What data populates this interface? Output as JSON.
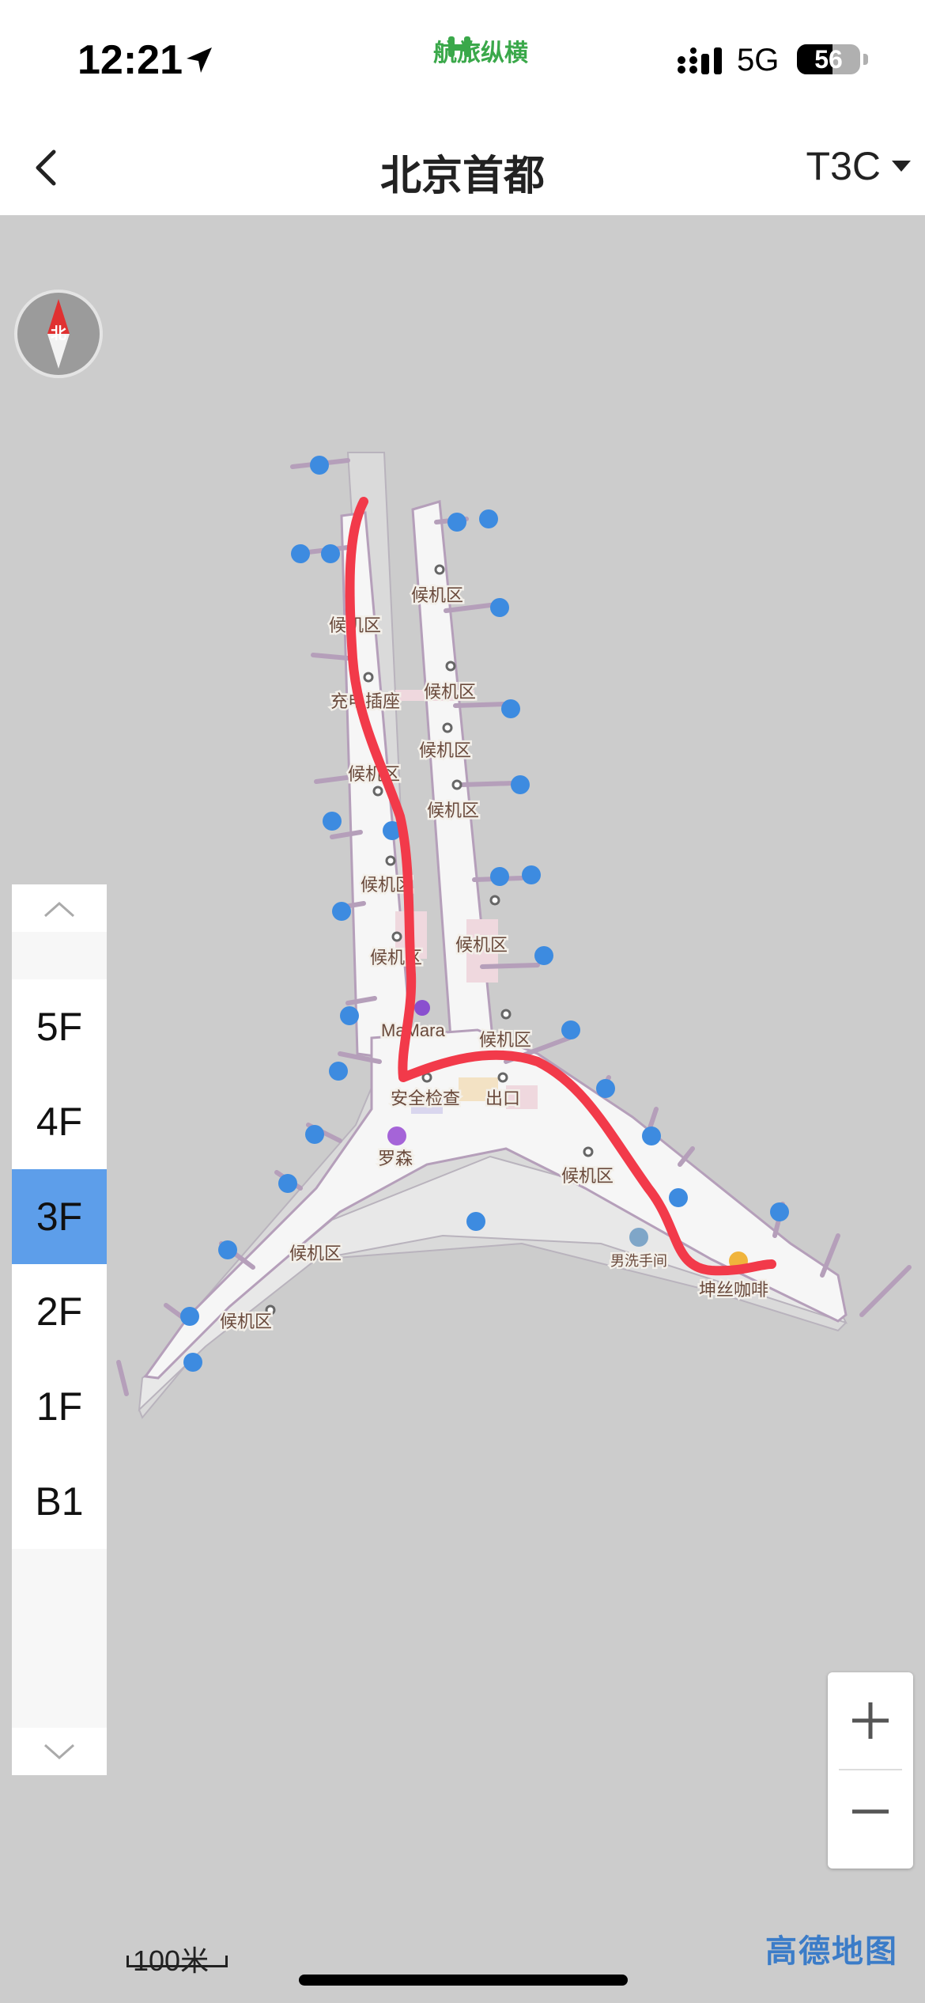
{
  "status_bar": {
    "time": "12:21",
    "carrier": "航旅纵横",
    "network": "5G",
    "battery": "56",
    "battery_percent": 56
  },
  "nav": {
    "title": "北京首都",
    "terminal": "T3C"
  },
  "compass": {
    "label": "北"
  },
  "floors": {
    "items": [
      "5F",
      "4F",
      "3F",
      "2F",
      "1F",
      "B1"
    ],
    "selected": "3F"
  },
  "map_labels": {
    "waiting_area": "候机区",
    "charging": "充电插座",
    "security": "安全检查",
    "exit": "出口",
    "mamara": "MaMara",
    "rosen": "罗森",
    "restroom": "男洗手间",
    "cafe": "坤丝咖啡"
  },
  "scale": {
    "label": "100米"
  },
  "brand": {
    "name": "高德地图"
  },
  "colors": {
    "map_background": "#cccccc",
    "building_fill": "#f4f4f4",
    "route": "#f23a4a",
    "floor_active": "#5d9eea",
    "poi_blue": "#3d8be0"
  }
}
